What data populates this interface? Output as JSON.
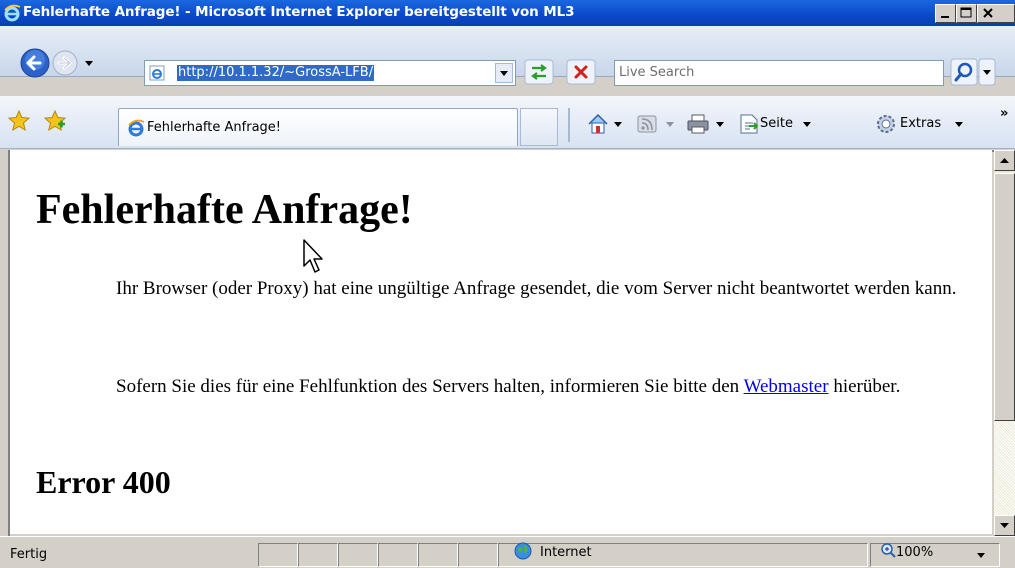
{
  "window": {
    "title": "Fehlerhafte Anfrage! - Microsoft Internet Explorer bereitgestellt von ML3"
  },
  "navbar": {
    "address_url": "http://10.1.1.32/~GrossA-LFB/",
    "search_placeholder": "Live Search"
  },
  "tabs": [
    {
      "label": "Fehlerhafte Anfrage!"
    }
  ],
  "commandbar": {
    "page_label": "Seite",
    "tools_label": "Extras",
    "overflow_label": "»"
  },
  "page": {
    "heading": "Fehlerhafte Anfrage!",
    "paragraph1": "Ihr Browser (oder Proxy) hat eine ungültige Anfrage gesendet, die vom Server nicht beantwortet werden kann.",
    "paragraph2_before": "Sofern Sie dies für eine Fehlfunktion des Servers halten, informieren Sie bitte den ",
    "link_text": "Webmaster",
    "paragraph2_after": " hierüber.",
    "error_heading": "Error 400"
  },
  "statusbar": {
    "status": "Fertig",
    "zone": "Internet",
    "zoom": "100%"
  },
  "colors": {
    "titlebar": "#0a48c8",
    "link": "#0000ee",
    "selection": "#316ac5"
  }
}
